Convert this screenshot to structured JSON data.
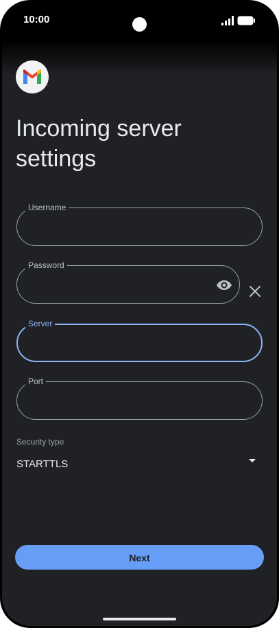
{
  "status_bar": {
    "time": "10:00"
  },
  "app": {
    "logo_icon": "gmail-logo-icon",
    "title": "Incoming server settings"
  },
  "form": {
    "username": {
      "label": "Username",
      "value": ""
    },
    "password": {
      "label": "Password",
      "value": "",
      "visibility_icon": "eye-icon",
      "clear_icon": "close-icon"
    },
    "server": {
      "label": "Server",
      "value": "",
      "focused": true
    },
    "port": {
      "label": "Port",
      "value": ""
    },
    "security_type": {
      "label": "Security type",
      "value": "STARTTLS",
      "icon": "dropdown-arrow-icon"
    }
  },
  "actions": {
    "next_label": "Next"
  },
  "colors": {
    "background": "#202124",
    "accent": "#8ab4f8",
    "button": "#669df6",
    "outline": "#9aa0a6"
  }
}
